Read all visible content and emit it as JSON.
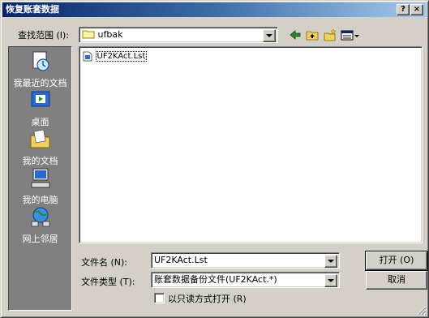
{
  "window": {
    "title": "恢复账套数据",
    "help_label": "?",
    "close_label": "×"
  },
  "lookin": {
    "label": "查找范围 (I):",
    "value": "ufbak"
  },
  "places": [
    {
      "label": "我最近的文档",
      "icon": "recent-documents-icon"
    },
    {
      "label": "桌面",
      "icon": "desktop-icon"
    },
    {
      "label": "我的文档",
      "icon": "my-documents-icon"
    },
    {
      "label": "我的电脑",
      "icon": "my-computer-icon"
    },
    {
      "label": "网上邻居",
      "icon": "network-places-icon"
    }
  ],
  "files": [
    {
      "name": "UF2KAct.Lst",
      "icon": "file-icon"
    }
  ],
  "filename": {
    "label": "文件名 (N):",
    "value": "UF2KAct.Lst"
  },
  "filetype": {
    "label": "文件类型 (T):",
    "value": "账套数据备份文件(UF2KAct.*)"
  },
  "readonly": {
    "label": "以只读方式打开 (R)",
    "checked": false
  },
  "buttons": {
    "open_label": "打开 (O)",
    "cancel_label": "取消"
  },
  "colors": {
    "title_start": "#0a246a",
    "title_end": "#a6caf0",
    "face": "#d4d0c8",
    "places_bg": "#808080"
  }
}
